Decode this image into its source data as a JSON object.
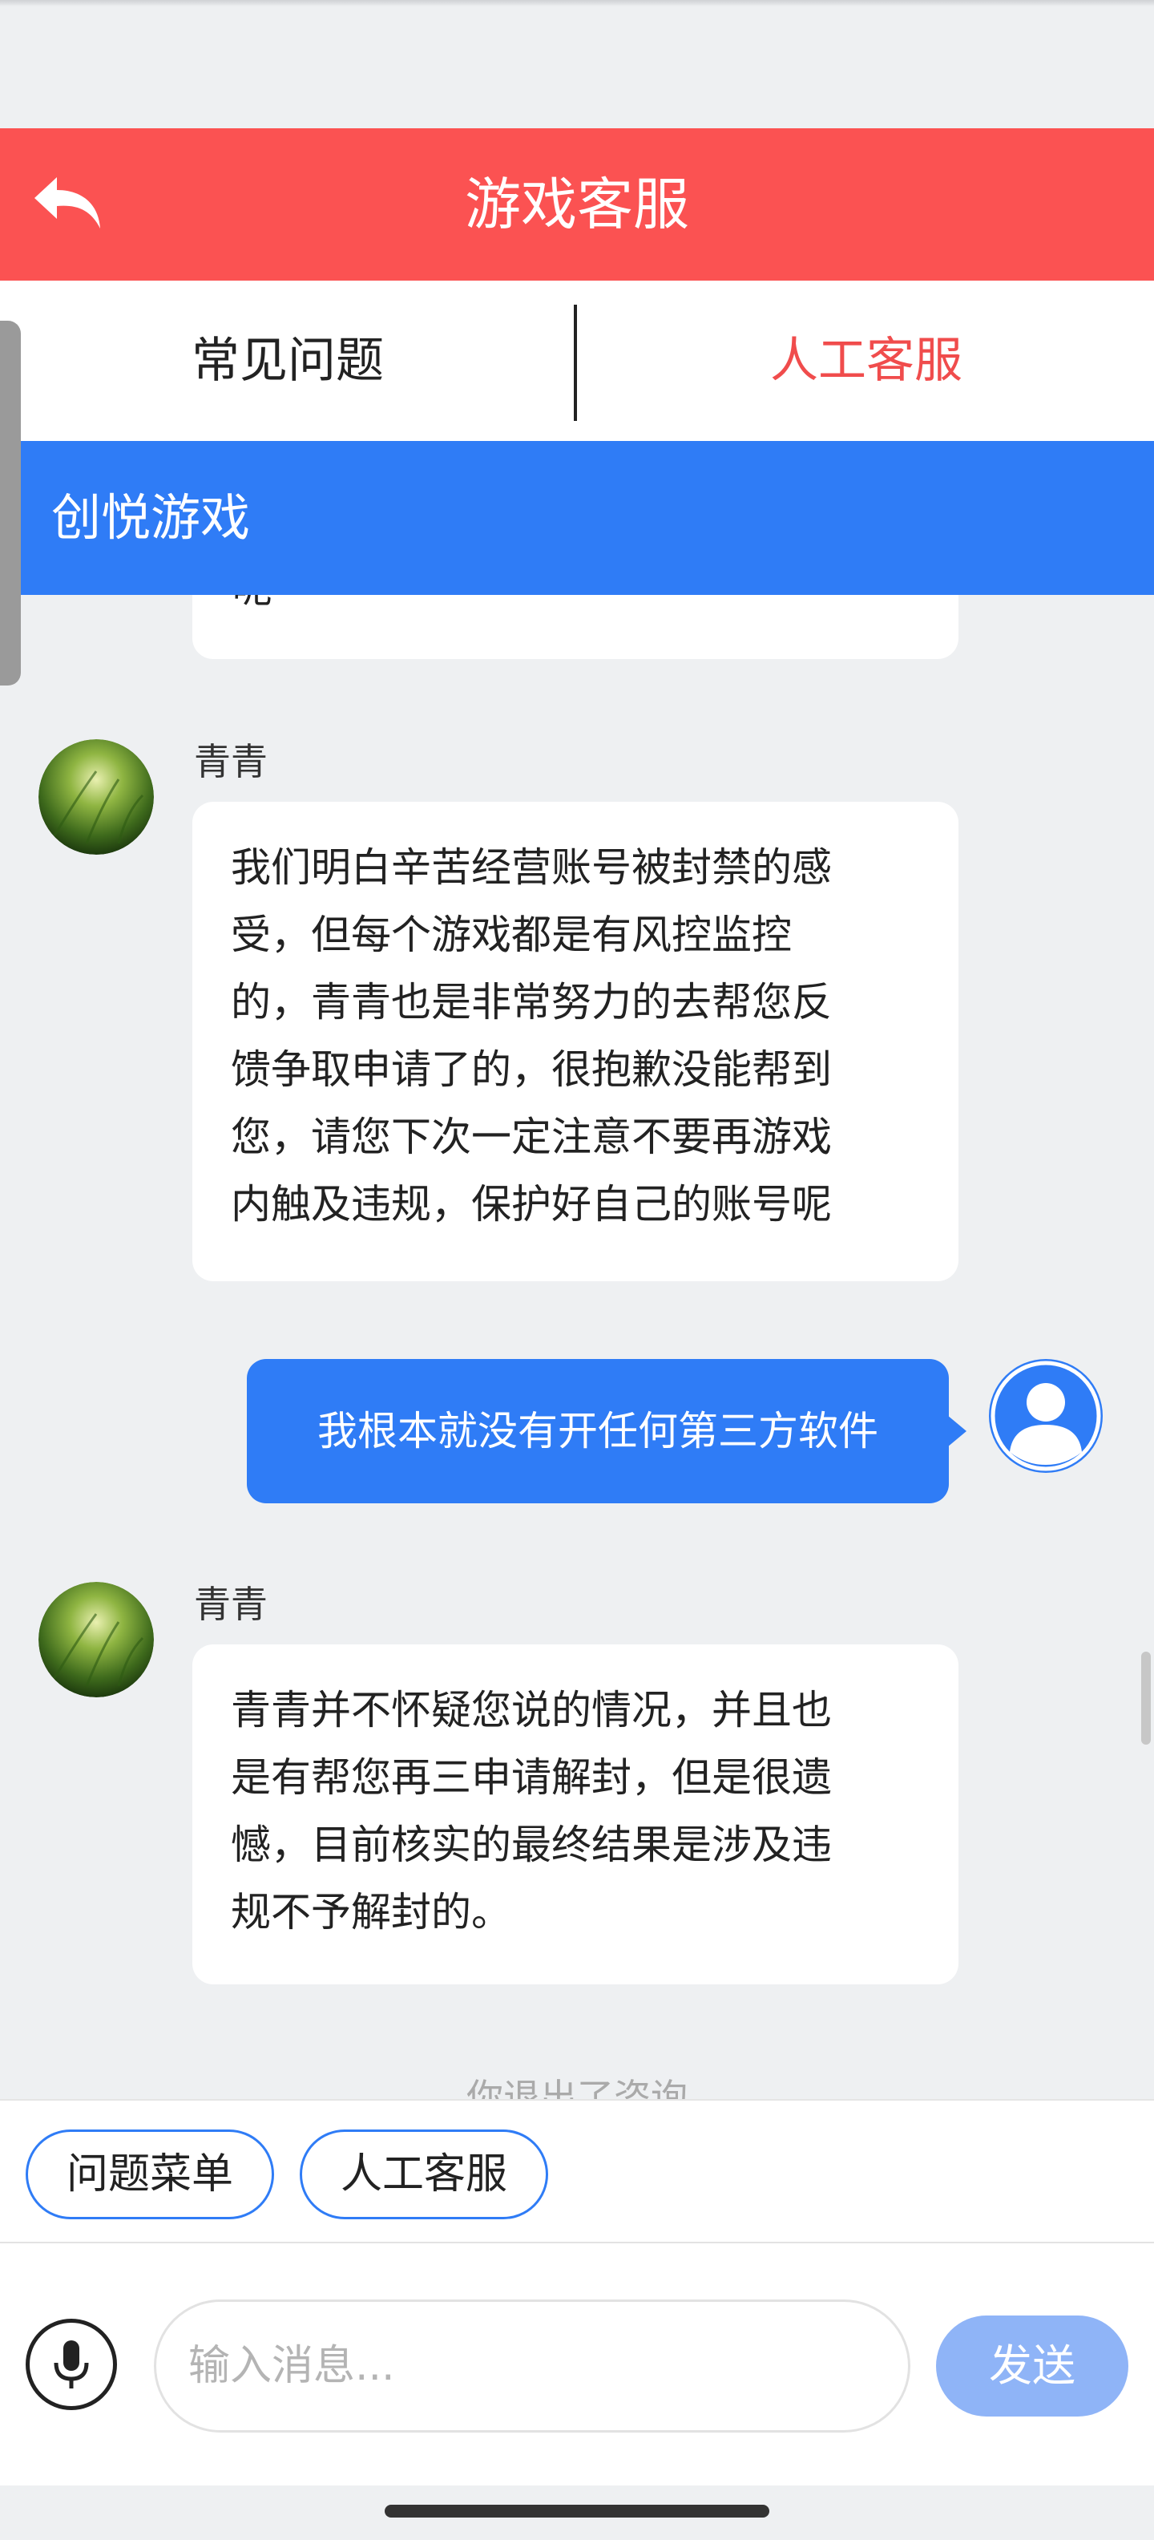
{
  "header": {
    "title": "游戏客服",
    "back_icon": "undo-arrow-icon",
    "bg_color": "#fb5252"
  },
  "tabs": [
    {
      "label": "常见问题",
      "active": false
    },
    {
      "label": "人工客服",
      "active": true
    }
  ],
  "brand": {
    "name": "创悦游戏",
    "bg_color": "#2f7cf6"
  },
  "chat": {
    "truncated_fragment": "呢",
    "messages": [
      {
        "sender": "青青",
        "side": "left",
        "text": "我们明白辛苦经营账号被封禁的感\n受，但每个游戏都是有风控监控\n的，青青也是非常努力的去帮您反\n馈争取申请了的，很抱歉没能帮到\n您，请您下次一定注意不要再游戏\n内触及违规，保护好自己的账号呢"
      },
      {
        "sender": "",
        "side": "right",
        "text": "我根本就没有开任何第三方软件"
      },
      {
        "sender": "青青",
        "side": "left",
        "text": "青青并不怀疑您说的情况，并且也\n是有帮您再三申请解封，但是很遗\n憾，目前核实的最终结果是涉及违\n规不予解封的。"
      }
    ],
    "system_message": "你退出了咨询"
  },
  "quick_actions": [
    {
      "label": "问题菜单"
    },
    {
      "label": "人工客服"
    }
  ],
  "input": {
    "placeholder": "输入消息...",
    "value": "",
    "mic_icon": "microphone-icon",
    "send_label": "发送"
  },
  "colors": {
    "accent_blue": "#2f7cf6",
    "header_red": "#fb5252",
    "active_tab_text": "#f04c4c",
    "send_disabled": "#8fb4f7"
  }
}
